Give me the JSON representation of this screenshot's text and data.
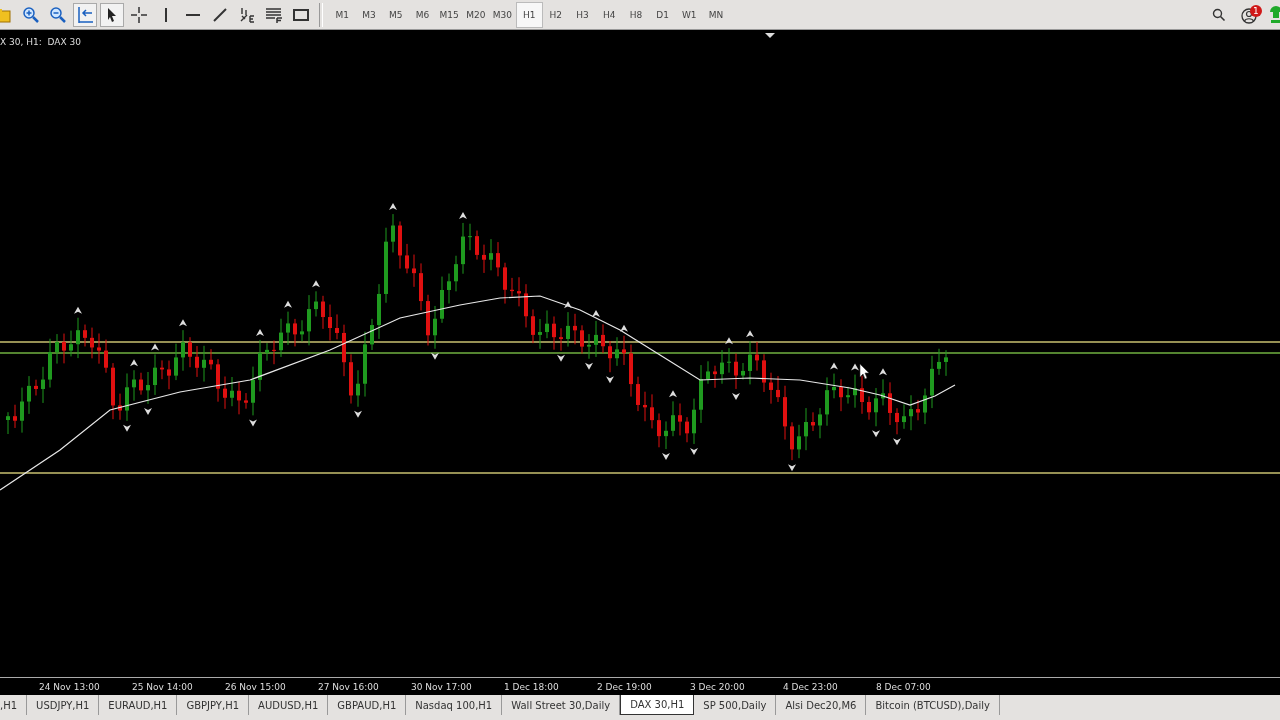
{
  "toolbar": {
    "tools": [
      {
        "kind": "folder",
        "selected": false
      },
      {
        "kind": "zoom-in",
        "selected": false
      },
      {
        "kind": "zoom-out",
        "selected": false
      },
      {
        "kind": "autoscroll",
        "selected": true
      },
      {
        "kind": "cursor",
        "selected": true
      },
      {
        "kind": "crosshair",
        "selected": false
      },
      {
        "kind": "vline",
        "selected": false
      },
      {
        "kind": "hline",
        "selected": false
      },
      {
        "kind": "trendline",
        "selected": false
      },
      {
        "kind": "fibo",
        "selected": false
      },
      {
        "kind": "flines",
        "selected": false
      },
      {
        "kind": "rectangle",
        "selected": false
      }
    ],
    "timeframes": [
      {
        "label": "M1",
        "selected": false
      },
      {
        "label": "M3",
        "selected": false
      },
      {
        "label": "M5",
        "selected": false
      },
      {
        "label": "M6",
        "selected": false
      },
      {
        "label": "M15",
        "selected": false
      },
      {
        "label": "M20",
        "selected": false
      },
      {
        "label": "M30",
        "selected": false
      },
      {
        "label": "H1",
        "selected": true
      },
      {
        "label": "H2",
        "selected": false
      },
      {
        "label": "H3",
        "selected": false
      },
      {
        "label": "H4",
        "selected": false
      },
      {
        "label": "H8",
        "selected": false
      },
      {
        "label": "D1",
        "selected": false
      },
      {
        "label": "W1",
        "selected": false
      },
      {
        "label": "MN",
        "selected": false
      }
    ],
    "notification_count": "1"
  },
  "chart": {
    "symbol_label": "X 30, H1:  DAX 30",
    "time_labels": [
      "24 Nov 13:00",
      "25 Nov 14:00",
      "26 Nov 15:00",
      "27 Nov 16:00",
      "30 Nov 17:00",
      "1 Dec 18:00",
      "2 Dec 19:00",
      "3 Dec 20:00",
      "4 Dec 23:00",
      "8 Dec 07:00"
    ]
  },
  "tabs": [
    {
      "label": ",H1",
      "selected": false
    },
    {
      "label": "USDJPY,H1",
      "selected": false
    },
    {
      "label": "EURAUD,H1",
      "selected": false
    },
    {
      "label": "GBPJPY,H1",
      "selected": false
    },
    {
      "label": "AUDUSD,H1",
      "selected": false
    },
    {
      "label": "GBPAUD,H1",
      "selected": false
    },
    {
      "label": "Nasdaq 100,H1",
      "selected": false
    },
    {
      "label": "Wall Street 30,Daily",
      "selected": false
    },
    {
      "label": "DAX 30,H1",
      "selected": true
    },
    {
      "label": "SP 500,Daily",
      "selected": false
    },
    {
      "label": "Alsi Dec20,M6",
      "selected": false
    },
    {
      "label": "Bitcoin (BTCUSD),Daily",
      "selected": false
    }
  ]
}
